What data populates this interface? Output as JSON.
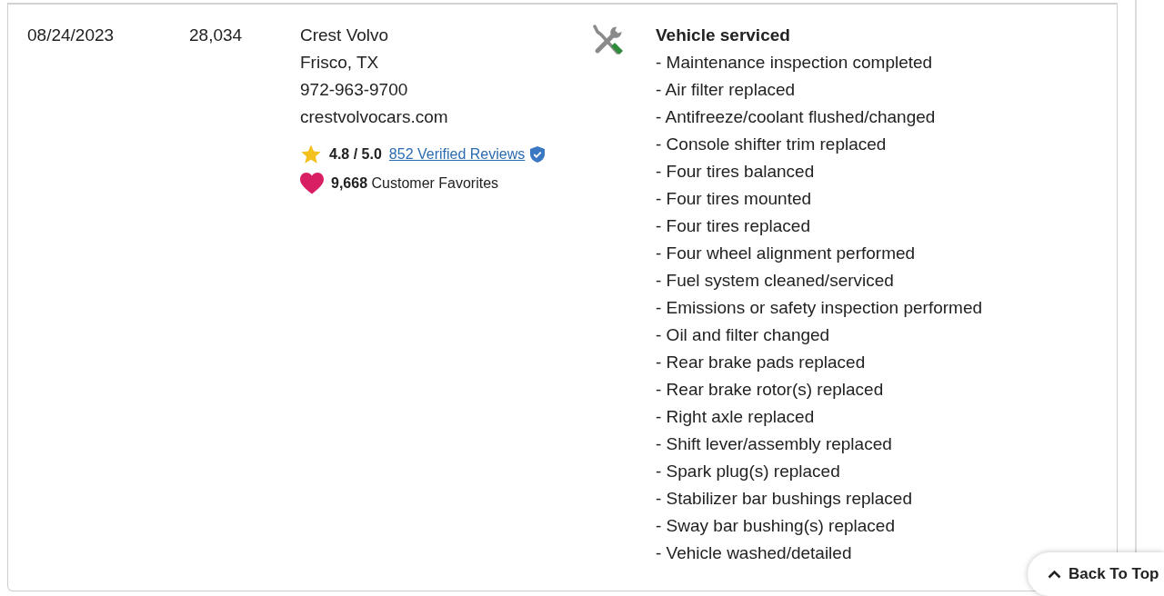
{
  "record": {
    "date": "08/24/2023",
    "mileage": "28,034",
    "shop": {
      "name": "Crest Volvo",
      "location": "Frisco, TX",
      "phone": "972-963-9700",
      "website": "crestvolvocars.com",
      "rating": "4.8 / 5.0",
      "reviews_link": "852 Verified Reviews",
      "favorites_count": "9,668",
      "favorites_label": "Customer Favorites"
    },
    "details": {
      "title": "Vehicle serviced",
      "items": [
        "- Maintenance inspection completed",
        "- Air filter replaced",
        "- Antifreeze/coolant flushed/changed",
        "- Console shifter trim replaced",
        "- Four tires balanced",
        "- Four tires mounted",
        "- Four tires replaced",
        "- Four wheel alignment performed",
        "- Fuel system cleaned/serviced",
        "- Emissions or safety inspection performed",
        "- Oil and filter changed",
        "- Rear brake pads replaced",
        "- Rear brake rotor(s) replaced",
        "- Right axle replaced",
        "- Shift lever/assembly replaced",
        "- Spark plug(s) replaced",
        "- Stabilizer bar bushings replaced",
        "- Sway bar bushing(s) replaced",
        "- Vehicle washed/detailed"
      ]
    }
  },
  "back_to_top": {
    "label": "Back To Top"
  }
}
